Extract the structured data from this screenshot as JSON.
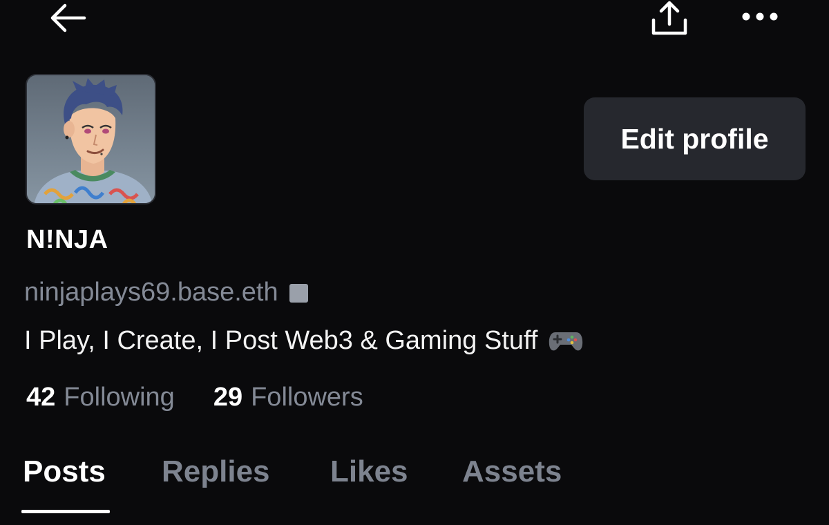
{
  "header": {
    "back_icon": "arrow-left-icon",
    "share_icon": "share-upload-icon",
    "more_icon": "more-horizontal-icon"
  },
  "profile": {
    "avatar_icon": "avatar-illustration",
    "display_name": "N!NJA",
    "handle": "ninjaplays69.base.eth",
    "verified_icon": "square-badge-icon",
    "bio": "I Play, I Create, I Post Web3 & Gaming Stuff",
    "bio_icon": "gamepad-icon",
    "edit_button_label": "Edit profile"
  },
  "stats": {
    "following": {
      "count": "42",
      "label": "Following"
    },
    "followers": {
      "count": "29",
      "label": "Followers"
    }
  },
  "tabs": [
    {
      "label": "Posts",
      "active": true
    },
    {
      "label": "Replies",
      "active": false
    },
    {
      "label": "Likes",
      "active": false
    },
    {
      "label": "Assets",
      "active": false
    }
  ],
  "colors": {
    "background": "#0a0a0c",
    "muted_text": "#848a96",
    "button_bg": "#26282e",
    "primary_text": "#ffffff"
  }
}
